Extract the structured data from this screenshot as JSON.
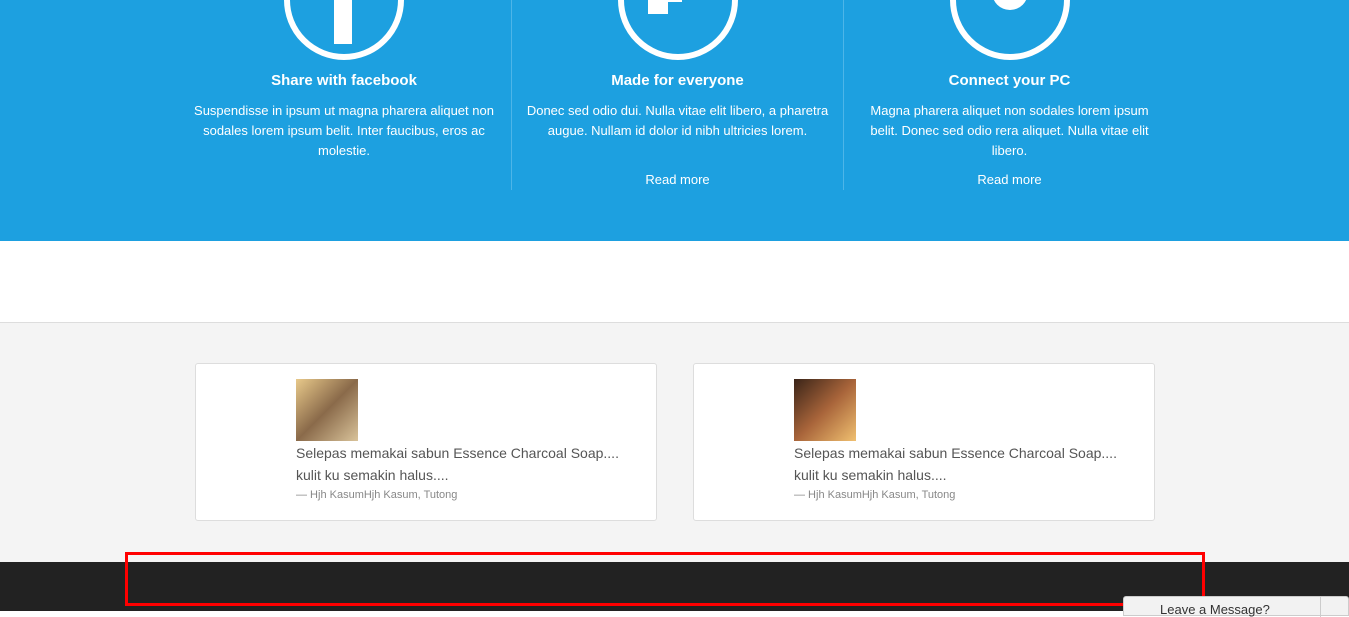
{
  "features": [
    {
      "title": "Share with facebook",
      "text": "Suspendisse in ipsum ut magna pharera aliquet non sodales lorem ipsum belit. Inter faucibus, eros ac molestie.",
      "icon": "facebook-icon"
    },
    {
      "title": "Made for everyone",
      "text": "Donec sed odio dui. Nulla vitae elit libero, a pharetra augue. Nullam id dolor id nibh ultricies lorem.",
      "link": "Read more",
      "icon": "plug-icon"
    },
    {
      "title": "Connect your PC",
      "text": "Magna pharera aliquet non sodales lorem ipsum belit. Donec sed odio rera aliquet. Nulla vitae elit libero.",
      "link": "Read more",
      "icon": "gear-icon"
    }
  ],
  "testimonials": [
    {
      "quote": "Selepas memakai sabun Essence Charcoal Soap.... kulit ku semakin halus....",
      "author": "— Hjh KasumHjh Kasum, Tutong"
    },
    {
      "quote": "Selepas memakai sabun Essence Charcoal Soap.... kulit ku semakin halus....",
      "author": "— Hjh KasumHjh Kasum, Tutong"
    }
  ],
  "chat": {
    "label": "Leave a Message?"
  },
  "colors": {
    "accent": "#1da0e0",
    "footer": "#222222"
  }
}
